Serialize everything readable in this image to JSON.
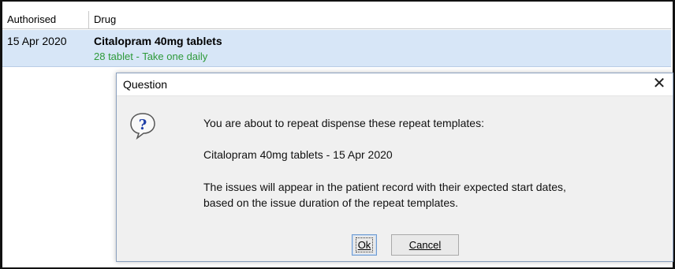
{
  "list": {
    "columns": {
      "authorised": "Authorised",
      "drug": "Drug"
    },
    "row": {
      "date": "15 Apr 2020",
      "drug_name": "Citalopram 40mg tablets",
      "dose": "28 tablet - Take one daily"
    }
  },
  "dialog": {
    "title": "Question",
    "close_glyph": "✕",
    "icon": "question-icon",
    "line1": "You are about to repeat dispense these repeat templates:",
    "line2": "Citalopram 40mg tablets - 15 Apr 2020",
    "line3": "The issues will appear in the patient record with their expected start dates,",
    "line4": "based on the issue duration of the repeat templates.",
    "ok_label": "Ok",
    "cancel_label": "Cancel"
  },
  "colors": {
    "row_highlight": "#d7e6f7",
    "dose_text": "#2e9a3a"
  }
}
